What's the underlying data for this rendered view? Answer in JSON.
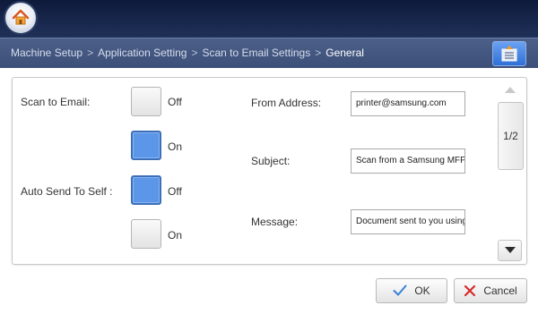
{
  "header": {
    "home_icon": "home-icon"
  },
  "breadcrumb": {
    "items": [
      "Machine Setup",
      "Application Setting",
      "Scan to Email Settings",
      "General"
    ],
    "separator": ">",
    "settings_icon": "settings-list-icon"
  },
  "form": {
    "scan_to_email": {
      "label": "Scan to Email:",
      "options": [
        {
          "label": "Off",
          "selected": false
        },
        {
          "label": "On",
          "selected": true
        }
      ]
    },
    "auto_send_to_self": {
      "label": "Auto Send To Self :",
      "options": [
        {
          "label": "Off",
          "selected": true
        },
        {
          "label": "On",
          "selected": false
        }
      ]
    },
    "from_address": {
      "label": "From Address:",
      "value": "printer@samsung.com"
    },
    "subject": {
      "label": "Subject:",
      "value": "Scan from a Samsung MFP"
    },
    "message": {
      "label": "Message:",
      "value": "Document sent to you using"
    }
  },
  "pager": {
    "text": "1/2"
  },
  "buttons": {
    "ok": "OK",
    "cancel": "Cancel"
  },
  "colors": {
    "selected": "#5b96e8",
    "header_bg": "#1a2a50",
    "breadcrumb_bg": "#44577f",
    "cancel_x": "#d62b2b",
    "ok_check": "#3a7fd8"
  }
}
